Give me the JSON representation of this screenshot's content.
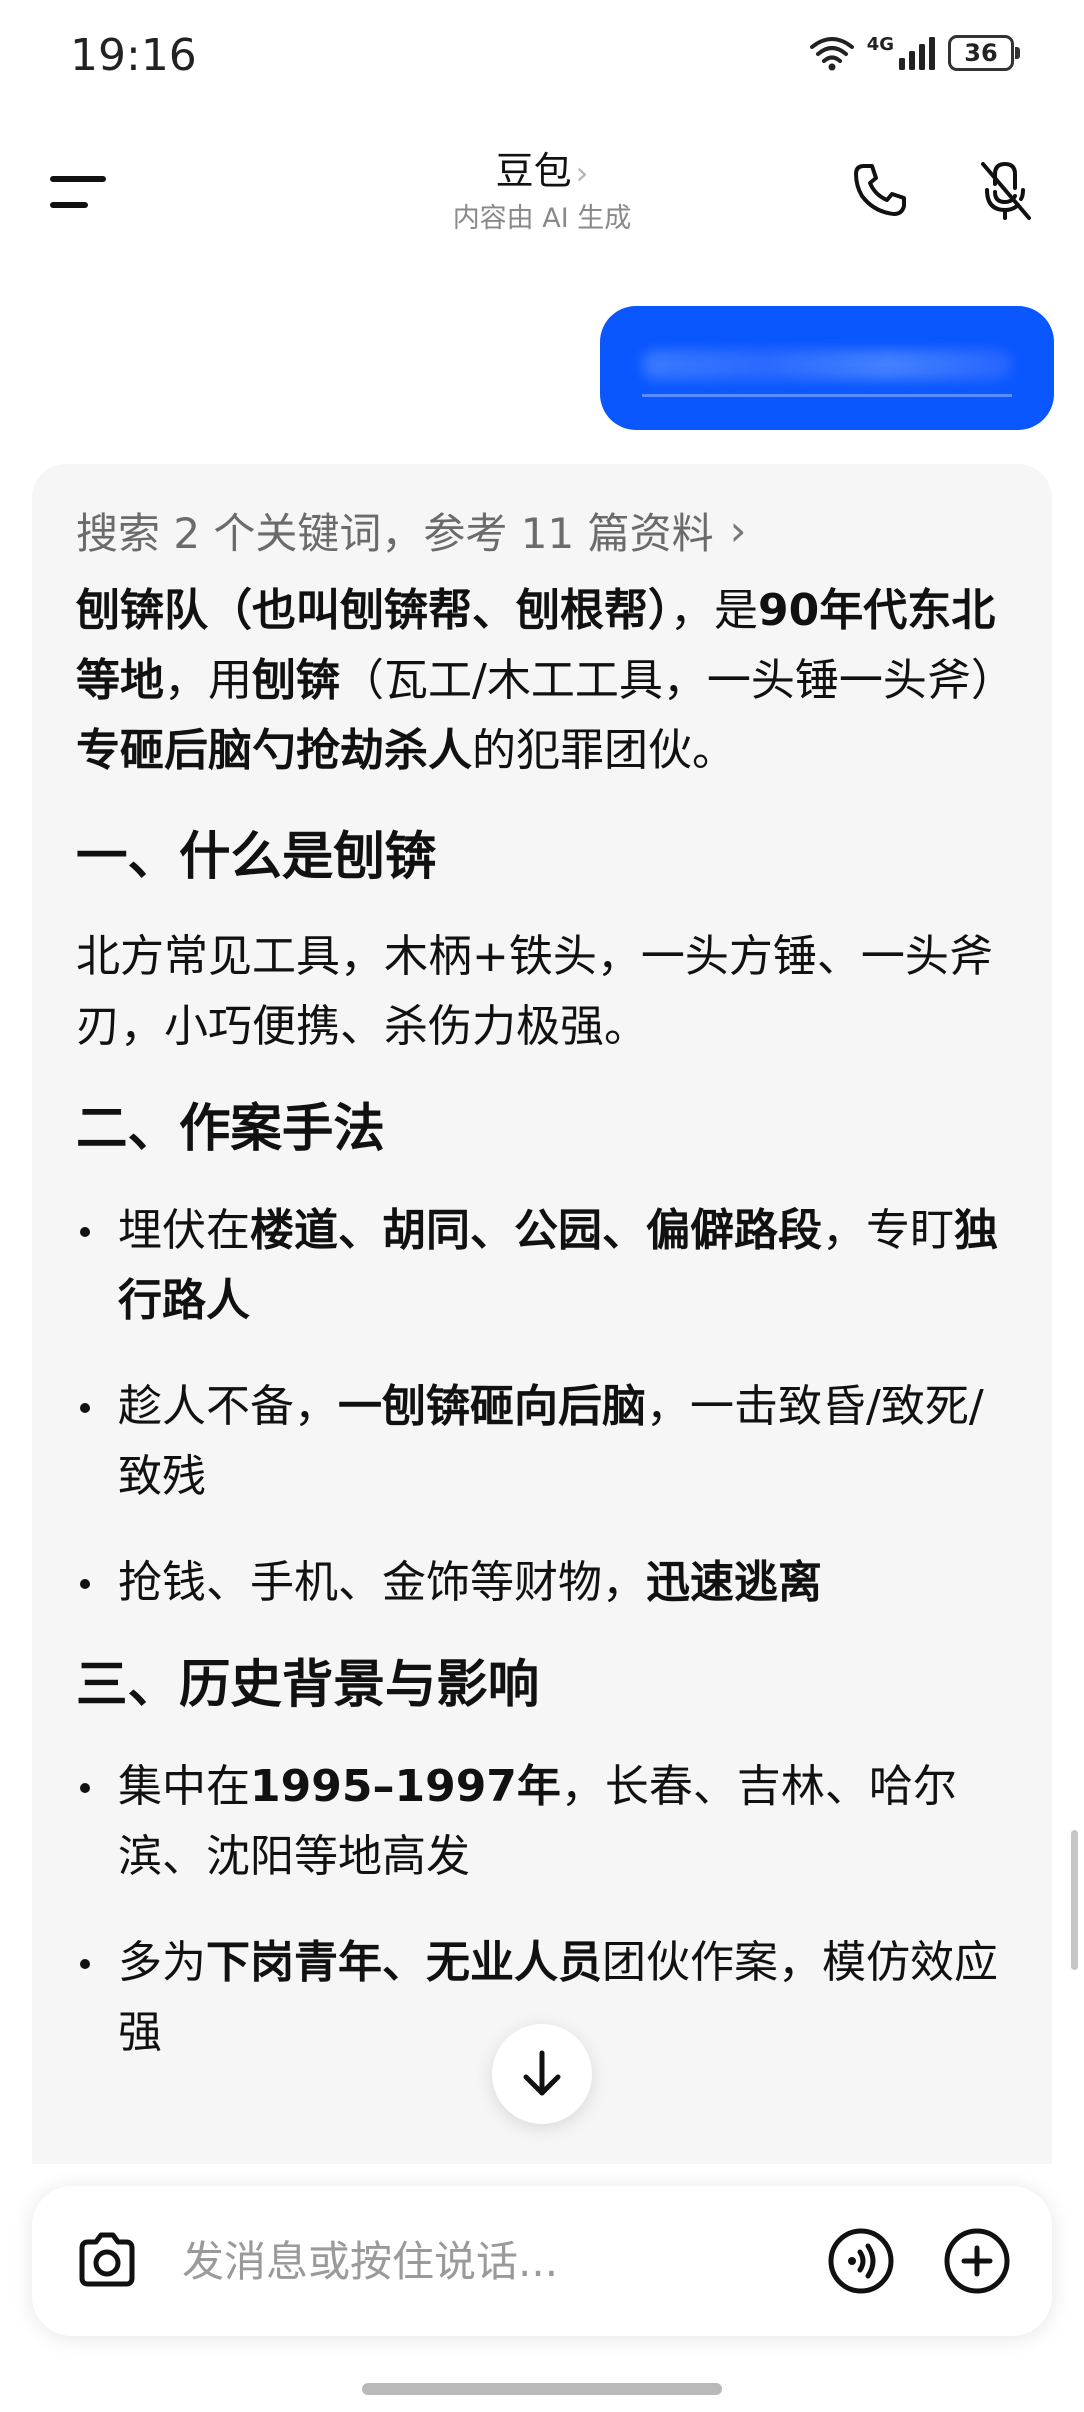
{
  "status_bar": {
    "time": "19:16",
    "network": "4G",
    "battery": "36"
  },
  "header": {
    "title": "豆包",
    "title_chevron": "›",
    "subtitle": "内容由 AI 生成",
    "icons": [
      "menu-icon",
      "phone-icon",
      "mute-microphone-icon"
    ]
  },
  "user_message": {
    "note": ""
  },
  "answer": {
    "search_summary": "搜索 2 个关键词，参考 11 篇资料",
    "search_arrow": "›",
    "intro": [
      {
        "t": "刨锛队（也叫刨锛帮、刨根帮）",
        "b": true
      },
      {
        "t": "，是",
        "b": false
      },
      {
        "t": "90年代东北等地",
        "b": true
      },
      {
        "t": "，用",
        "b": false
      },
      {
        "t": "刨锛",
        "b": true
      },
      {
        "t": "（瓦工/木工工具，一头锤一头斧）",
        "b": false
      },
      {
        "t": "专砸后脑勺抢劫杀人",
        "b": true
      },
      {
        "t": "的犯罪团伙。",
        "b": false
      }
    ],
    "section1_heading": "一、什么是刨锛",
    "section1_text": "北方常见工具，木柄+铁头，一头方锤、一头斧刃，小巧便携、杀伤力极强。",
    "section2_heading": "二、作案手法",
    "section2_items": [
      [
        {
          "t": "埋伏在",
          "b": false
        },
        {
          "t": "楼道、胡同、公园、偏僻路段",
          "b": true
        },
        {
          "t": "，专盯",
          "b": false
        },
        {
          "t": "独行路人",
          "b": true
        }
      ],
      [
        {
          "t": "趁人不备，",
          "b": false
        },
        {
          "t": "一刨锛砸向后脑",
          "b": true
        },
        {
          "t": "，一击致昏/致死/致残",
          "b": false
        }
      ],
      [
        {
          "t": "抢钱、手机、金饰等财物，",
          "b": false
        },
        {
          "t": "迅速逃离",
          "b": true
        }
      ]
    ],
    "section3_heading": "三、历史背景与影响",
    "section3_items": [
      [
        {
          "t": "集中在",
          "b": false
        },
        {
          "t": "1995–1997年",
          "b": true
        },
        {
          "t": "，长春、吉林、哈尔滨、沈阳等地高发",
          "b": false
        }
      ],
      [
        {
          "t": "多为",
          "b": false
        },
        {
          "t": "下岗青年、无业人员",
          "b": true
        },
        {
          "t": "团伙作案，模仿效应强",
          "b": false
        }
      ]
    ]
  },
  "input_bar": {
    "placeholder": "发消息或按住说话...",
    "icons": [
      "camera-icon",
      "voice-call-icon",
      "plus-icon"
    ]
  },
  "scroll_down_icon": "arrow-down-icon",
  "colors": {
    "accent_blue": "#0a57ff",
    "card_bg": "#f6f6f6",
    "muted_text": "#8a8a8a"
  }
}
